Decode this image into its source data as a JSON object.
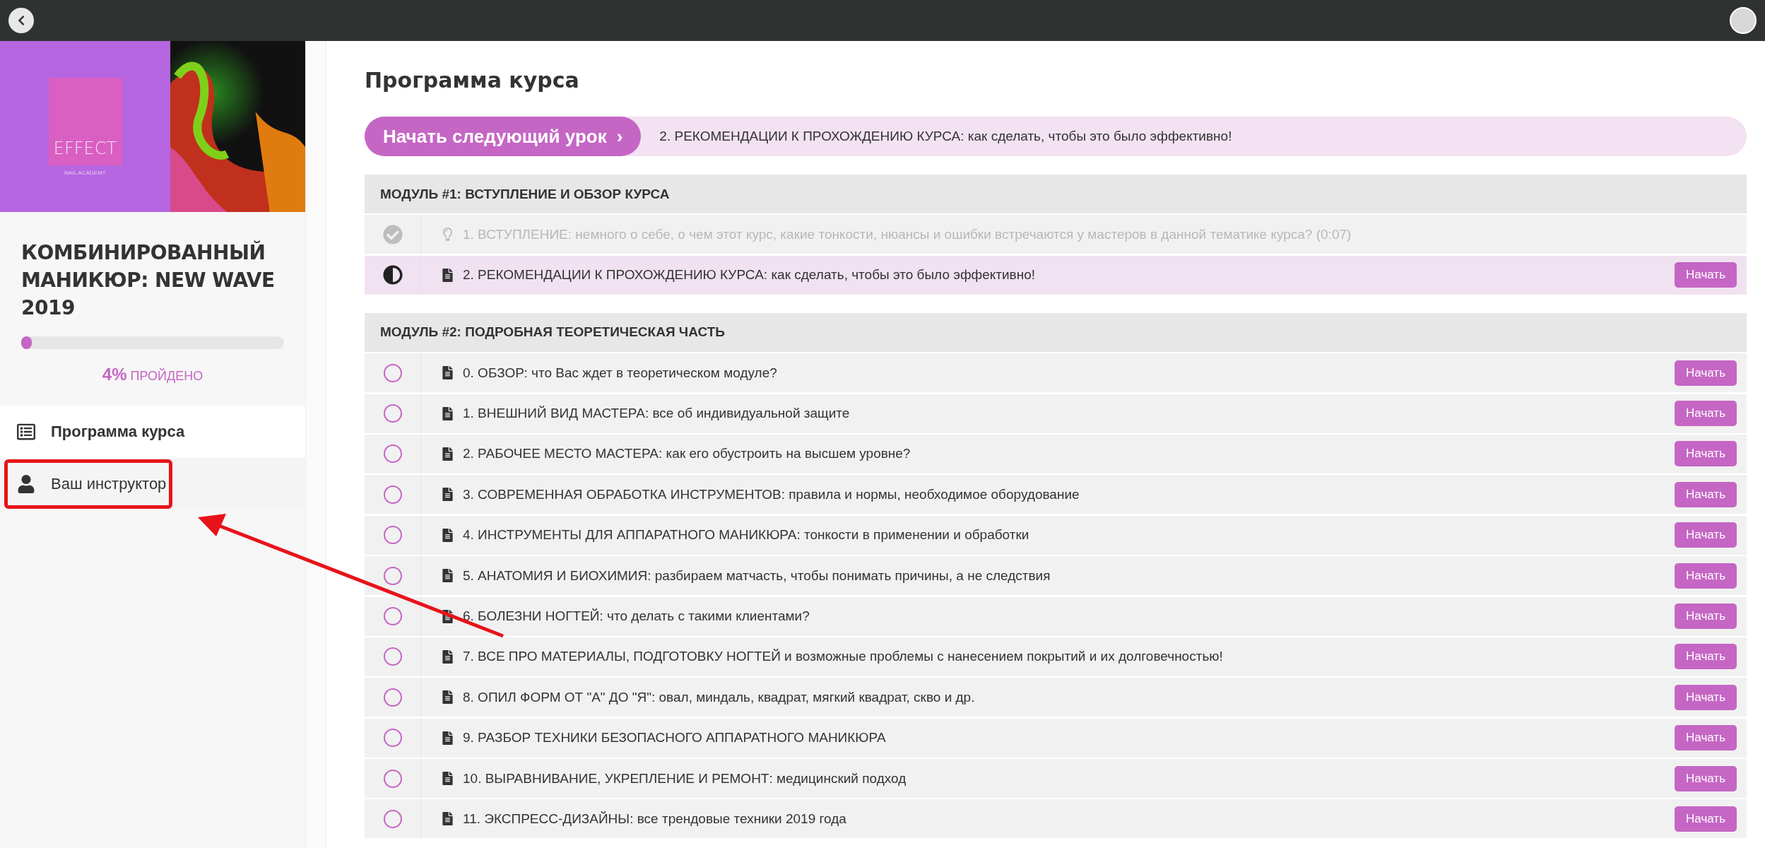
{
  "sidebar": {
    "logo": {
      "name": "EFFECT",
      "tagline": "NAIL ACADEMY"
    },
    "course_title": "КОМБИНИРОВАННЫЙ МАНИКЮР: NEW WAVE 2019",
    "progress": {
      "level": 0.04,
      "percent": "4%",
      "label": "ПРОЙДЕНО"
    },
    "menu": [
      {
        "kind": "list",
        "label": "Программа курса",
        "selected": true,
        "highlighted": false
      },
      {
        "kind": "user",
        "label": "Ваш инструктор",
        "selected": false,
        "highlighted": true
      }
    ]
  },
  "main": {
    "title": "Программа курса",
    "next_lesson": {
      "button": "Начать следующий урок",
      "arrow": "›",
      "lesson": "2. РЕКОМЕНДАЦИИ К ПРОХОЖДЕНИЮ КУРСА: как сделать, чтобы это было эффективно!"
    },
    "modules": [
      {
        "title": "МОДУЛЬ #1: ВСТУПЛЕНИЕ И ОБЗОР КУРСА",
        "lessons": [
          {
            "completed": true,
            "selected": false,
            "kind": "video",
            "title": "1. ВСТУПЛЕНИЕ: немного о себе, о чем этот курс, какие тонкости, нюансы и ошибки встречаются у мастеров в данной тематике курса? (0:07)"
          },
          {
            "completed": false,
            "selected": true,
            "kind": "text",
            "title": "2. РЕКОМЕНДАЦИИ К ПРОХОЖДЕНИЮ КУРСА: как сделать, чтобы это было эффективно!",
            "button": "Начать"
          }
        ]
      },
      {
        "title": "МОДУЛЬ #2: ПОДРОБНАЯ ТЕОРЕТИЧЕСКАЯ ЧАСТЬ",
        "lessons": [
          {
            "completed": false,
            "selected": false,
            "kind": "text",
            "title": "0. ОБЗОР: что Вас ждет в теоретическом модуле?",
            "button": "Начать"
          },
          {
            "completed": false,
            "selected": false,
            "kind": "text",
            "title": "1. ВНЕШНИЙ ВИД МАСТЕРА: все об индивидуальной защите",
            "button": "Начать"
          },
          {
            "completed": false,
            "selected": false,
            "kind": "text",
            "title": "2. РАБОЧЕЕ МЕСТО МАСТЕРА: как его обустроить на высшем уровне?",
            "button": "Начать"
          },
          {
            "completed": false,
            "selected": false,
            "kind": "text",
            "title": "3. СОВРЕМЕННАЯ ОБРАБОТКА ИНСТРУМЕНТОВ: правила и нормы, необходимое оборудование",
            "button": "Начать"
          },
          {
            "completed": false,
            "selected": false,
            "kind": "text",
            "title": "4. ИНСТРУМЕНТЫ ДЛЯ АППАРАТНОГО МАНИКЮРА: тонкости в применении и обработки",
            "button": "Начать"
          },
          {
            "completed": false,
            "selected": false,
            "kind": "text",
            "title": "5. АНАТОМИЯ И БИОХИМИЯ: разбираем матчасть, чтобы понимать причины, а не следствия",
            "button": "Начать"
          },
          {
            "completed": false,
            "selected": false,
            "kind": "text",
            "title": "6. БОЛЕЗНИ НОГТЕЙ: что делать с такими клиентами?",
            "button": "Начать"
          },
          {
            "completed": false,
            "selected": false,
            "kind": "text",
            "title": "7. ВСЕ ПРО МАТЕРИАЛЫ, ПОДГОТОВКУ НОГТЕЙ и возможные проблемы с нанесением покрытий и их долговечностью!",
            "button": "Начать"
          },
          {
            "completed": false,
            "selected": false,
            "kind": "text",
            "title": "8. ОПИЛ ФОРМ ОТ \"А\" ДО \"Я\": овал, миндаль, квадрат, мягкий квадрат, скво и др.",
            "button": "Начать"
          },
          {
            "completed": false,
            "selected": false,
            "kind": "text",
            "title": "9. РАЗБОР ТЕХНИКИ БЕЗОПАСНОГО АППАРАТНОГО МАНИКЮРА",
            "button": "Начать"
          },
          {
            "completed": false,
            "selected": false,
            "kind": "text",
            "title": "10. ВЫРАВНИВАНИЕ, УКРЕПЛЕНИЕ И РЕМОНТ: медицинский подход",
            "button": "Начать"
          },
          {
            "completed": false,
            "selected": false,
            "kind": "text",
            "title": "11. ЭКСПРЕСС-ДИЗАЙНЫ: все трендовые техники 2019 года",
            "button": "Начать"
          }
        ]
      }
    ]
  }
}
